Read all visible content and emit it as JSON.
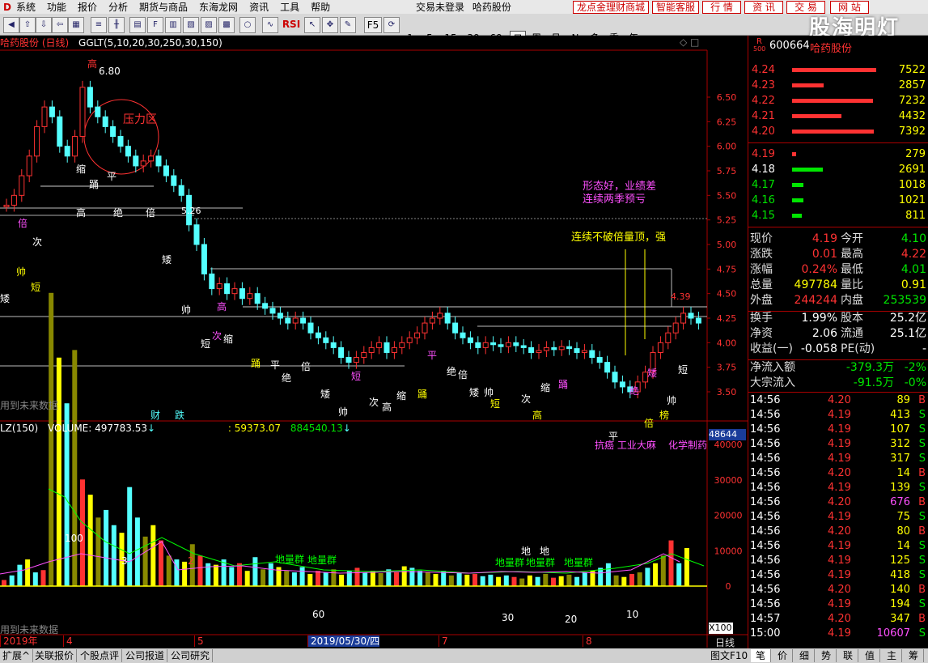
{
  "menu": {
    "items": [
      "系统",
      "功能",
      "报价",
      "分析",
      "期货与商品",
      "东海龙网",
      "资讯",
      "工具",
      "帮助"
    ],
    "login_status": "交易未登录",
    "stock_name": "哈药股份"
  },
  "top_buttons": [
    "龙点金理财商城",
    "智能客服",
    "行 情",
    "资 讯",
    "交 易",
    "网 站"
  ],
  "watermark": "股海明灯",
  "toolbar": {
    "periods": [
      "1",
      "5",
      "15",
      "30",
      "60",
      "日",
      "周",
      "月",
      "N",
      "多",
      "季",
      "年"
    ],
    "rsi_label": "RSI",
    "f5_label": "F5"
  },
  "main_chart": {
    "title": "哈药股份 (日线)",
    "indicator": "GGLT(5,10,20,30,250,30,150)",
    "price_ticks": [
      "6.50",
      "6.25",
      "6.00",
      "5.75",
      "5.50",
      "5.25",
      "5.00",
      "4.75",
      "4.50",
      "4.25",
      "4.00",
      "3.75",
      "3.50"
    ],
    "high_label": "高",
    "high_value": "6.80",
    "pressure_label": "压力区",
    "level_526": "5.26",
    "level_439": "4.39",
    "annotation_1": "形态好，业绩差",
    "annotation_2": "连续两季预亏",
    "annotation_3": "连续不破倍量顶，强",
    "future_data": "用到未来数据",
    "marker_cai": "财",
    "marker_die": "跌",
    "marker_bang": "榜",
    "signal_labels": [
      "倍",
      "矮",
      "帅",
      "短",
      "次",
      "高",
      "缩",
      "踊",
      "平",
      "绝"
    ]
  },
  "volume_chart": {
    "title": "LZ(150)",
    "volume_label": "VOLUME: 497783.53",
    "value_2": ": 59373.07",
    "value_3": "884540.13",
    "ticks": [
      "40000",
      "30000",
      "20000",
      "10000",
      "0"
    ],
    "scale_box": "48644",
    "scale_mult": "X100",
    "news_1": "抗癌 工业大麻",
    "news_2": "化学制药",
    "future_data": "用到未来数据",
    "labels": [
      "地量群",
      "地量群",
      "地量群",
      "地量群",
      "地量群",
      "地",
      "地"
    ],
    "small_numbers": [
      "60",
      "30",
      "20",
      "10",
      "100",
      "3",
      "2"
    ]
  },
  "date_axis": {
    "labels": [
      "2019年",
      "4",
      "5",
      "2019/05/30/四",
      "7",
      "8"
    ],
    "right_label": "日线"
  },
  "quote": {
    "code": "600664",
    "name": "哈药股份",
    "r_label": "R",
    "r_sub": "500",
    "asks": [
      {
        "price": "4.24",
        "vol": "7522",
        "bar": 0.8
      },
      {
        "price": "4.23",
        "vol": "2857",
        "bar": 0.3
      },
      {
        "price": "4.22",
        "vol": "7232",
        "bar": 0.77
      },
      {
        "price": "4.21",
        "vol": "4432",
        "bar": 0.47
      },
      {
        "price": "4.20",
        "vol": "7392",
        "bar": 0.78
      }
    ],
    "bids": [
      {
        "price": "4.19",
        "vol": "279",
        "bar": 0.03,
        "side": "red"
      },
      {
        "price": "4.18",
        "vol": "2691",
        "bar": 0.29,
        "side": "grn"
      },
      {
        "price": "4.17",
        "vol": "1018",
        "bar": 0.11,
        "side": "grn"
      },
      {
        "price": "4.16",
        "vol": "1021",
        "bar": 0.11,
        "side": "grn"
      },
      {
        "price": "4.15",
        "vol": "811",
        "bar": 0.09,
        "side": "grn"
      }
    ],
    "stats": [
      {
        "l1": "现价",
        "v1": "4.19",
        "c1": "red",
        "l2": "今开",
        "v2": "4.10",
        "c2": "grn"
      },
      {
        "l1": "涨跌",
        "v1": "0.01",
        "c1": "red",
        "l2": "最高",
        "v2": "4.22",
        "c2": "red"
      },
      {
        "l1": "涨幅",
        "v1": "0.24%",
        "c1": "red",
        "l2": "最低",
        "v2": "4.01",
        "c2": "grn"
      },
      {
        "l1": "总量",
        "v1": "497784",
        "c1": "yel",
        "l2": "量比",
        "v2": "0.91",
        "c2": "yel"
      },
      {
        "l1": "外盘",
        "v1": "244244",
        "c1": "red",
        "l2": "内盘",
        "v2": "253539",
        "c2": "grn"
      }
    ],
    "stats2": [
      {
        "l1": "换手",
        "v1": "1.99%",
        "l2": "股本",
        "v2": "25.2亿"
      },
      {
        "l1": "净资",
        "v1": "2.06",
        "l2": "流通",
        "v2": "25.1亿"
      },
      {
        "l1": "收益(一)",
        "v1": "-0.058",
        "l2": "PE(动)",
        "v2": "-"
      }
    ],
    "flows": [
      {
        "label": "净流入额",
        "value": "-379.3万",
        "pct": "-2%"
      },
      {
        "label": "大宗流入",
        "value": "-91.5万",
        "pct": "-0%"
      }
    ],
    "ticks": [
      {
        "t": "14:56",
        "p": "4.20",
        "pc": "red",
        "v": "89",
        "vc": "yel",
        "s": "B",
        "sc": "red"
      },
      {
        "t": "14:56",
        "p": "4.19",
        "pc": "red",
        "v": "413",
        "vc": "yel",
        "s": "S",
        "sc": "grn"
      },
      {
        "t": "14:56",
        "p": "4.19",
        "pc": "red",
        "v": "107",
        "vc": "yel",
        "s": "S",
        "sc": "grn"
      },
      {
        "t": "14:56",
        "p": "4.19",
        "pc": "red",
        "v": "312",
        "vc": "yel",
        "s": "S",
        "sc": "grn"
      },
      {
        "t": "14:56",
        "p": "4.19",
        "pc": "red",
        "v": "317",
        "vc": "yel",
        "s": "S",
        "sc": "grn"
      },
      {
        "t": "14:56",
        "p": "4.20",
        "pc": "red",
        "v": "14",
        "vc": "yel",
        "s": "B",
        "sc": "red"
      },
      {
        "t": "14:56",
        "p": "4.19",
        "pc": "red",
        "v": "139",
        "vc": "yel",
        "s": "S",
        "sc": "grn"
      },
      {
        "t": "14:56",
        "p": "4.20",
        "pc": "red",
        "v": "676",
        "vc": "mag",
        "s": "B",
        "sc": "red"
      },
      {
        "t": "14:56",
        "p": "4.19",
        "pc": "red",
        "v": "75",
        "vc": "yel",
        "s": "S",
        "sc": "grn"
      },
      {
        "t": "14:56",
        "p": "4.20",
        "pc": "red",
        "v": "80",
        "vc": "yel",
        "s": "B",
        "sc": "red"
      },
      {
        "t": "14:56",
        "p": "4.19",
        "pc": "red",
        "v": "14",
        "vc": "yel",
        "s": "S",
        "sc": "grn"
      },
      {
        "t": "14:56",
        "p": "4.19",
        "pc": "red",
        "v": "125",
        "vc": "yel",
        "s": "S",
        "sc": "grn"
      },
      {
        "t": "14:56",
        "p": "4.19",
        "pc": "red",
        "v": "418",
        "vc": "yel",
        "s": "S",
        "sc": "grn"
      },
      {
        "t": "14:56",
        "p": "4.20",
        "pc": "red",
        "v": "140",
        "vc": "yel",
        "s": "B",
        "sc": "red"
      },
      {
        "t": "14:56",
        "p": "4.19",
        "pc": "red",
        "v": "194",
        "vc": "yel",
        "s": "S",
        "sc": "grn"
      },
      {
        "t": "14:57",
        "p": "4.20",
        "pc": "red",
        "v": "347",
        "vc": "yel",
        "s": "B",
        "sc": "red"
      },
      {
        "t": "15:00",
        "p": "4.19",
        "pc": "red",
        "v": "10607",
        "vc": "mag",
        "s": "S",
        "sc": "grn"
      }
    ]
  },
  "bottom_tabs": [
    "扩展^",
    "关联报价",
    "个股点评",
    "公司报道",
    "公司研究"
  ],
  "bottom_right": {
    "f10": "图文F10",
    "tabs": [
      "笔",
      "价",
      "细",
      "势",
      "联",
      "值",
      "主",
      "筹"
    ]
  },
  "colors": {
    "up": "#ff3232",
    "down": "#54ffff",
    "bg": "#000000",
    "grid": "#a00000"
  }
}
